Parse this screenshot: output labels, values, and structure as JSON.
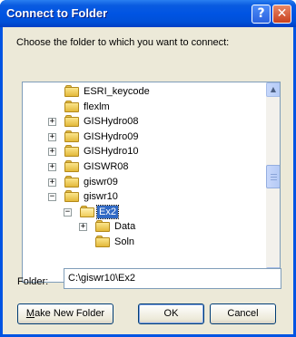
{
  "window": {
    "title": "Connect to Folder",
    "help_glyph": "?",
    "close_glyph": "✕"
  },
  "prompt": "Choose the folder to which you want to connect:",
  "tree": {
    "items": [
      {
        "label": "ESRI_keycode",
        "expander": "",
        "level": 0,
        "open": false,
        "selected": false
      },
      {
        "label": "flexlm",
        "expander": "",
        "level": 0,
        "open": false,
        "selected": false
      },
      {
        "label": "GISHydro08",
        "expander": "+",
        "level": 0,
        "open": false,
        "selected": false
      },
      {
        "label": "GISHydro09",
        "expander": "+",
        "level": 0,
        "open": false,
        "selected": false
      },
      {
        "label": "GISHydro10",
        "expander": "+",
        "level": 0,
        "open": false,
        "selected": false
      },
      {
        "label": "GISWR08",
        "expander": "+",
        "level": 0,
        "open": false,
        "selected": false
      },
      {
        "label": "giswr09",
        "expander": "+",
        "level": 0,
        "open": false,
        "selected": false
      },
      {
        "label": "giswr10",
        "expander": "−",
        "level": 0,
        "open": false,
        "selected": false
      },
      {
        "label": "Ex2",
        "expander": "−",
        "level": 1,
        "open": true,
        "selected": true
      },
      {
        "label": "Data",
        "expander": "+",
        "level": 2,
        "open": false,
        "selected": false
      },
      {
        "label": "Soln",
        "expander": "",
        "level": 2,
        "open": false,
        "selected": false
      }
    ],
    "scroll_up_glyph": "▲",
    "scroll_down_glyph": "▼"
  },
  "folder": {
    "label": "Folder:",
    "value": "C:\\giswr10\\Ex2"
  },
  "buttons": {
    "new_folder_mnemonic": "M",
    "new_folder_rest": "ake New Folder",
    "ok": "OK",
    "cancel": "Cancel"
  }
}
